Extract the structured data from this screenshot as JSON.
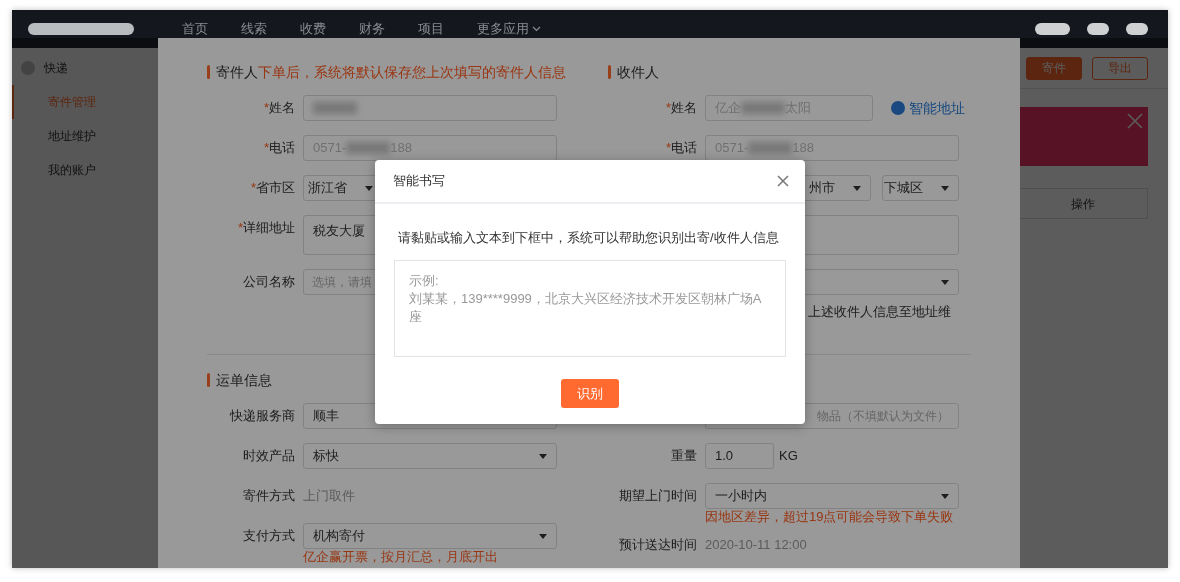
{
  "nav": {
    "items": [
      {
        "label": "首页"
      },
      {
        "label": "线索"
      },
      {
        "label": "收费"
      },
      {
        "label": "财务"
      },
      {
        "label": "项目"
      },
      {
        "label": "更多应用",
        "kind": "menu"
      }
    ]
  },
  "sidebar": {
    "header": "快递",
    "items": [
      {
        "label": "寄件管理",
        "selected": true
      },
      {
        "label": "地址维护",
        "selected": false
      },
      {
        "label": "我的账户",
        "selected": false
      }
    ]
  },
  "toolbar": {
    "buttons": [
      {
        "label": "寄件",
        "kind": "primary"
      },
      {
        "label": "导出",
        "kind": "outline"
      }
    ]
  },
  "table": {
    "columns": [
      "操作"
    ]
  },
  "sender": {
    "title": "寄件人",
    "note": "下单后，系统将默认保存您上次填写的寄件人信息",
    "fields": [
      {
        "label": "姓名",
        "mark": "*",
        "kind": "input",
        "redacted": true
      },
      {
        "label": "电话",
        "mark": "*",
        "kind": "input",
        "redacted": true,
        "value_parts": [
          "0571-",
          "188"
        ]
      },
      {
        "label": "省市区",
        "mark": "*",
        "kind": "region",
        "selects": [
          {
            "value": "浙江省",
            "caret": true
          }
        ]
      },
      {
        "label": "详细地址",
        "mark": "*",
        "kind": "textarea",
        "value": "税友大厦"
      },
      {
        "label": "公司名称",
        "kind": "input",
        "placeholder": "选填，请填"
      }
    ]
  },
  "receiver": {
    "title": "收件人",
    "fields": [
      {
        "label": "姓名",
        "mark": "*",
        "kind": "input",
        "narrow": true,
        "redacted": true,
        "value_parts": [
          "亿企",
          "太阳"
        ],
        "link": "智能地址"
      },
      {
        "label": "电话",
        "mark": "*",
        "kind": "input",
        "redacted": true,
        "value_parts": [
          "0571-",
          "188"
        ]
      },
      {
        "kind": "region",
        "selects": [
          {
            "value": "州市",
            "caret": true
          },
          {
            "value": "下城区",
            "caret": true
          }
        ]
      },
      {
        "kind": "textarea"
      },
      {
        "kind": "select",
        "caret": true
      },
      {
        "kind": "hint",
        "value": "上述收件人信息至地址维"
      }
    ]
  },
  "waybill": {
    "title": "运单信息",
    "left": [
      {
        "label": "快递服务商",
        "kind": "select",
        "value": "顺丰"
      },
      {
        "label": "时效产品",
        "kind": "select",
        "value": "标快",
        "caret": true
      },
      {
        "label": "寄件方式",
        "kind": "static",
        "value": "上门取件"
      },
      {
        "label": "支付方式",
        "kind": "select",
        "value": "机构寄付",
        "caret": true,
        "note": "亿企赢开票，按月汇总，月底开出"
      }
    ],
    "right": [
      {
        "kind": "input",
        "align_end": true,
        "placeholder": "物品（不填默认为文件）"
      },
      {
        "label": "重量",
        "kind": "input",
        "short": true,
        "value": "1.0",
        "suffix": "KG"
      },
      {
        "label": "期望上门时间",
        "kind": "select",
        "value": "一小时内",
        "caret": true,
        "note": "因地区差异，超过19点可能会导致下单失败"
      },
      {
        "label": "预计送达时间",
        "kind": "static",
        "value": "2020-10-11  12:00"
      }
    ]
  },
  "modal": {
    "title": "智能书写",
    "instruction": "请黏贴或输入文本到下框中，系统可以帮助您识别出寄/收件人信息",
    "placeholder": "示例:\n刘某某，139****9999，北京大兴区经济技术开发区朝林广场A座",
    "button": "识别"
  }
}
